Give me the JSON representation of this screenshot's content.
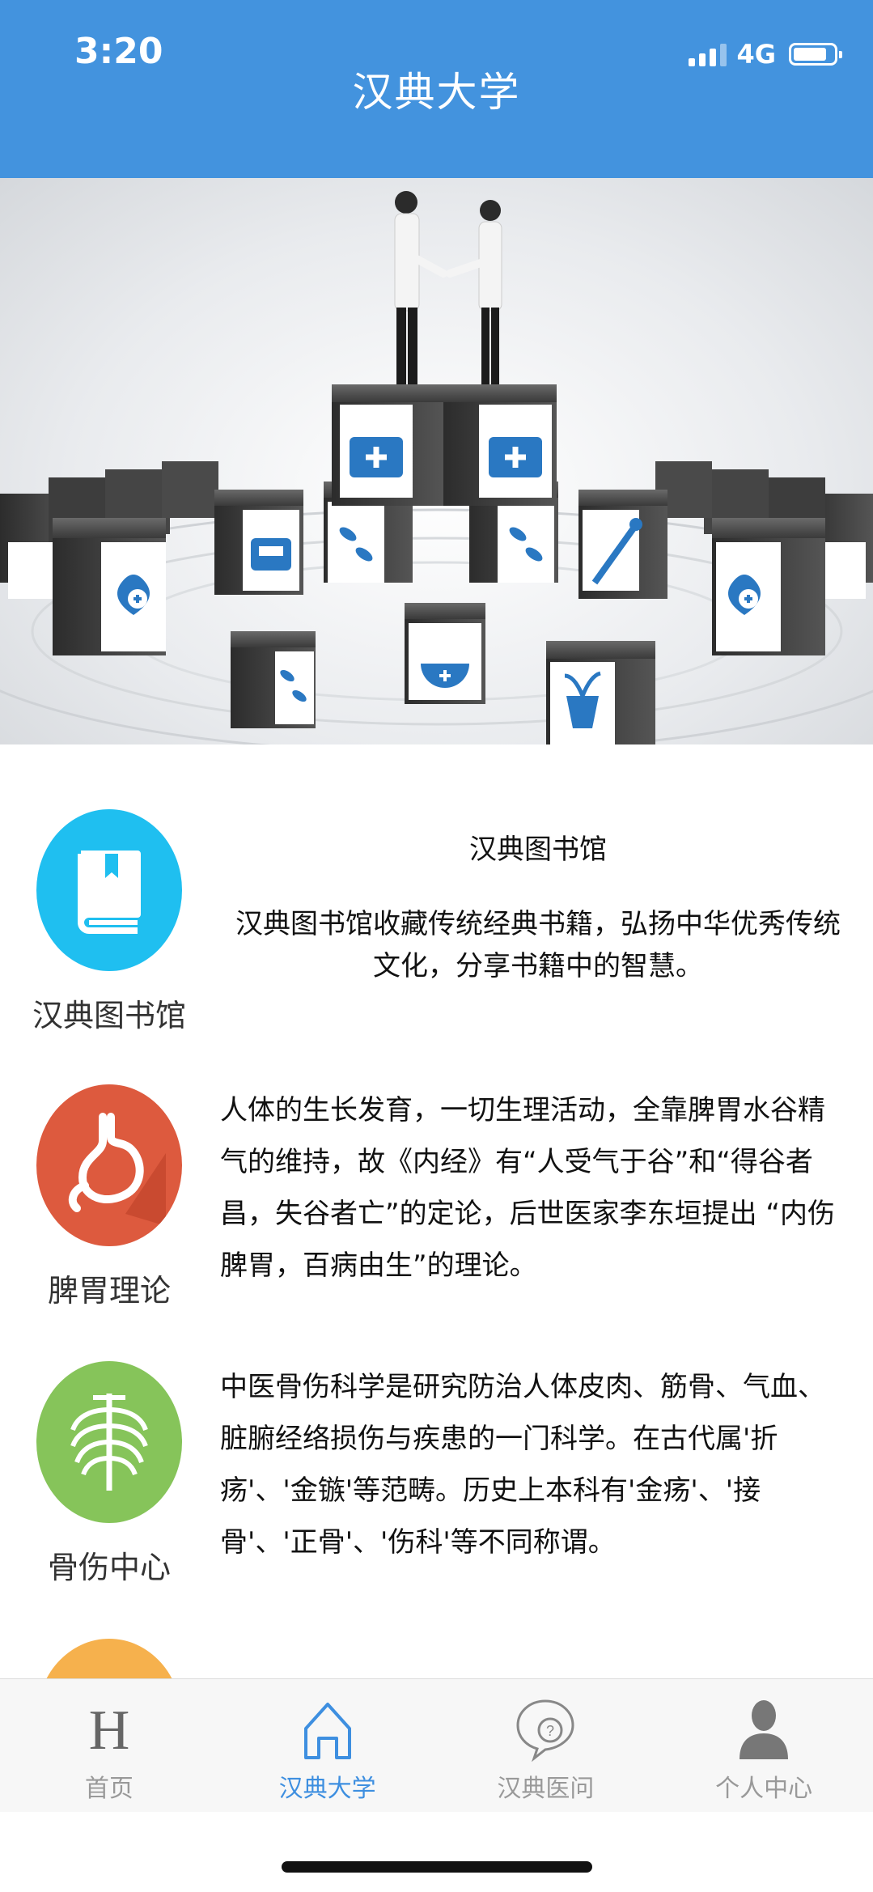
{
  "status_bar": {
    "time": "3:20",
    "network": "4G"
  },
  "header": {
    "title": "汉典大学"
  },
  "sections": [
    {
      "label": "汉典图书馆",
      "title": "汉典图书馆",
      "description": "汉典图书馆收藏传统经典书籍，弘扬中华优秀传统文化，分享书籍中的智慧。",
      "icon": "book-icon",
      "color": "#1fbff0"
    },
    {
      "label": "脾胃理论",
      "description": "人体的生长发育，一切生理活动，全靠脾胃水谷精气的维持，故《内经》有“人受气于谷”和“得谷者昌，失谷者亡”的定论，后世医家李东垣提出 “内伤脾胃，百病由生”的理论。",
      "icon": "stomach-icon",
      "color": "#dd5a3e"
    },
    {
      "label": "骨伤中心",
      "description": "中医骨伤科学是研究防治人体皮肉、筋骨、气血、脏腑经络损伤与疾患的一门科学。在古代属'折疡'、'金镞'等范畴。历史上本科有'金疡'、'接骨'、'正骨'、'伤科'等不同称谓。",
      "icon": "ribcage-icon",
      "color": "#86c45a"
    },
    {
      "icon": "partial-icon",
      "color": "#f6b14d"
    }
  ],
  "tabbar": {
    "tabs": [
      {
        "label": "首页",
        "icon": "home-h-icon",
        "active": false
      },
      {
        "label": "汉典大学",
        "icon": "house-icon",
        "active": true
      },
      {
        "label": "汉典医问",
        "icon": "question-chat-icon",
        "active": false
      },
      {
        "label": "个人中心",
        "icon": "person-icon",
        "active": false
      }
    ]
  },
  "colors": {
    "header": "#4393de",
    "accent": "#3e8fe0",
    "inactive": "#999999"
  }
}
